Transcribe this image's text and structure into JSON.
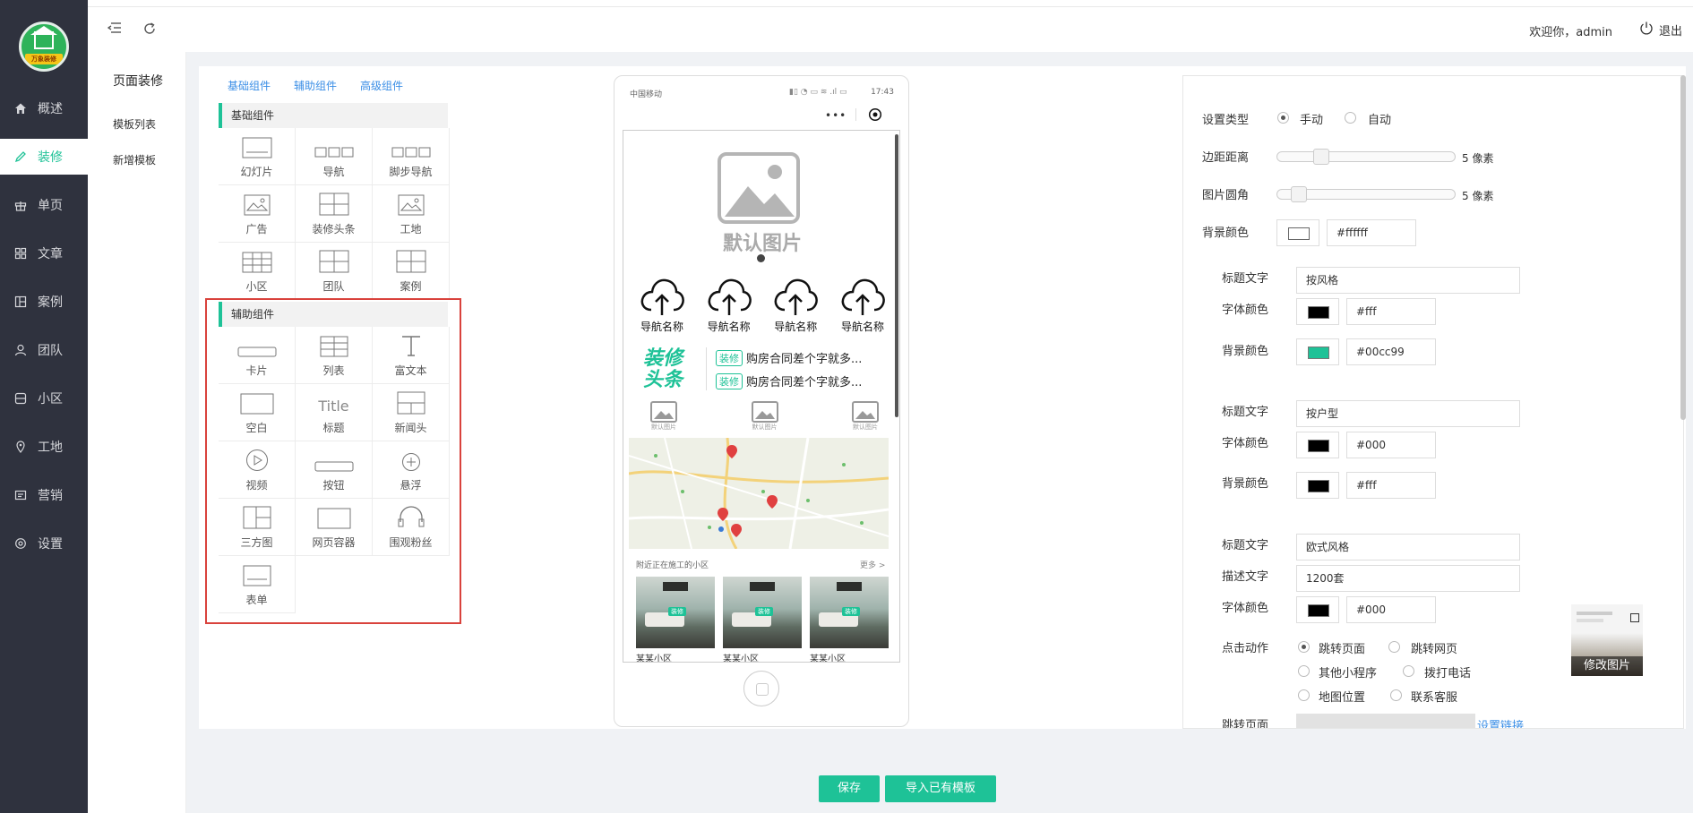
{
  "sidebar": {
    "logo_text": "万象装修",
    "items": [
      {
        "label": "概述",
        "icon": "home-icon"
      },
      {
        "label": "装修",
        "icon": "pencil-icon",
        "active": true
      },
      {
        "label": "单页",
        "icon": "gift-icon"
      },
      {
        "label": "文章",
        "icon": "grid-icon"
      },
      {
        "label": "案例",
        "icon": "layout-icon"
      },
      {
        "label": "团队",
        "icon": "user-icon"
      },
      {
        "label": "小区",
        "icon": "building-icon"
      },
      {
        "label": "工地",
        "icon": "location-icon"
      },
      {
        "label": "营销",
        "icon": "marketing-icon"
      },
      {
        "label": "设置",
        "icon": "gear-icon"
      }
    ]
  },
  "header": {
    "welcome": "欢迎你，admin",
    "logout": "退出"
  },
  "submenu": {
    "title": "页面装修",
    "links": [
      "模板列表",
      "新增模板"
    ]
  },
  "palette": {
    "tabs": [
      "基础组件",
      "辅助组件",
      "高级组件"
    ],
    "basic_title": "基础组件",
    "basic_items": [
      "幻灯片",
      "导航",
      "脚步导航",
      "广告",
      "装修头条",
      "工地",
      "小区",
      "团队",
      "案例"
    ],
    "aux_title": "辅助组件",
    "aux_items": [
      "卡片",
      "列表",
      "富文本",
      "空白",
      "标题",
      "新闻头",
      "视频",
      "按钮",
      "悬浮",
      "三方图",
      "网页容器",
      "围观粉丝",
      "表单"
    ],
    "title_glyph": "Title"
  },
  "phone": {
    "carrier": "中国移动",
    "time": "17:43",
    "default_image": "默认图片",
    "nav_items": [
      "导航名称",
      "导航名称",
      "导航名称",
      "导航名称"
    ],
    "headline_logo_line1": "装修",
    "headline_logo_line2": "头条",
    "headline_tag": "装修",
    "headline_text": "购房合同差个字就多...",
    "ad_caption": "默认图片",
    "nearby_title": "附近正在施工的小区",
    "nearby_more": "更多 >",
    "community_name": "某某小区",
    "community_badge": "装修"
  },
  "settings": {
    "type_label": "设置类型",
    "type_options": [
      "手动",
      "自动"
    ],
    "margin_label": "边距距离",
    "margin_value": "5 像素",
    "margin_level": 0.22,
    "radius_label": "图片圆角",
    "radius_value": "5 像素",
    "radius_level": 0.08,
    "bg_label": "背景颜色",
    "bg_value": "#ffffff",
    "groups": [
      {
        "title_label": "标题文字",
        "title": "按风格",
        "font_label": "字体颜色",
        "font_color": "#fff",
        "font_swatch": "#000000",
        "bg_label": "背景颜色",
        "bg_color": "#00cc99",
        "bg_swatch": "#1ec297"
      },
      {
        "title_label": "标题文字",
        "title": "按户型",
        "font_label": "字体颜色",
        "font_color": "#000",
        "font_swatch": "#000000",
        "bg_label": "背景颜色",
        "bg_color": "#fff",
        "bg_swatch": "#000000"
      }
    ],
    "group3": {
      "title_label": "标题文字",
      "title": "欧式风格",
      "desc_label": "描述文字",
      "desc": "1200套",
      "font_label": "字体颜色",
      "font_color": "#000",
      "action_label": "点击动作",
      "actions": [
        "跳转页面",
        "跳转网页",
        "其他小程序",
        "拨打电话",
        "地图位置",
        "联系客服"
      ],
      "jump_label": "跳转页面",
      "set_link": "设置链接",
      "modify_image": "修改图片"
    }
  },
  "buttons": {
    "save": "保存",
    "import": "导入已有模板"
  },
  "colors": {
    "accent": "#1ec297",
    "sidebar_bg": "#2f323e",
    "link": "#3a8ee6",
    "highlight_box": "#d9423c"
  }
}
